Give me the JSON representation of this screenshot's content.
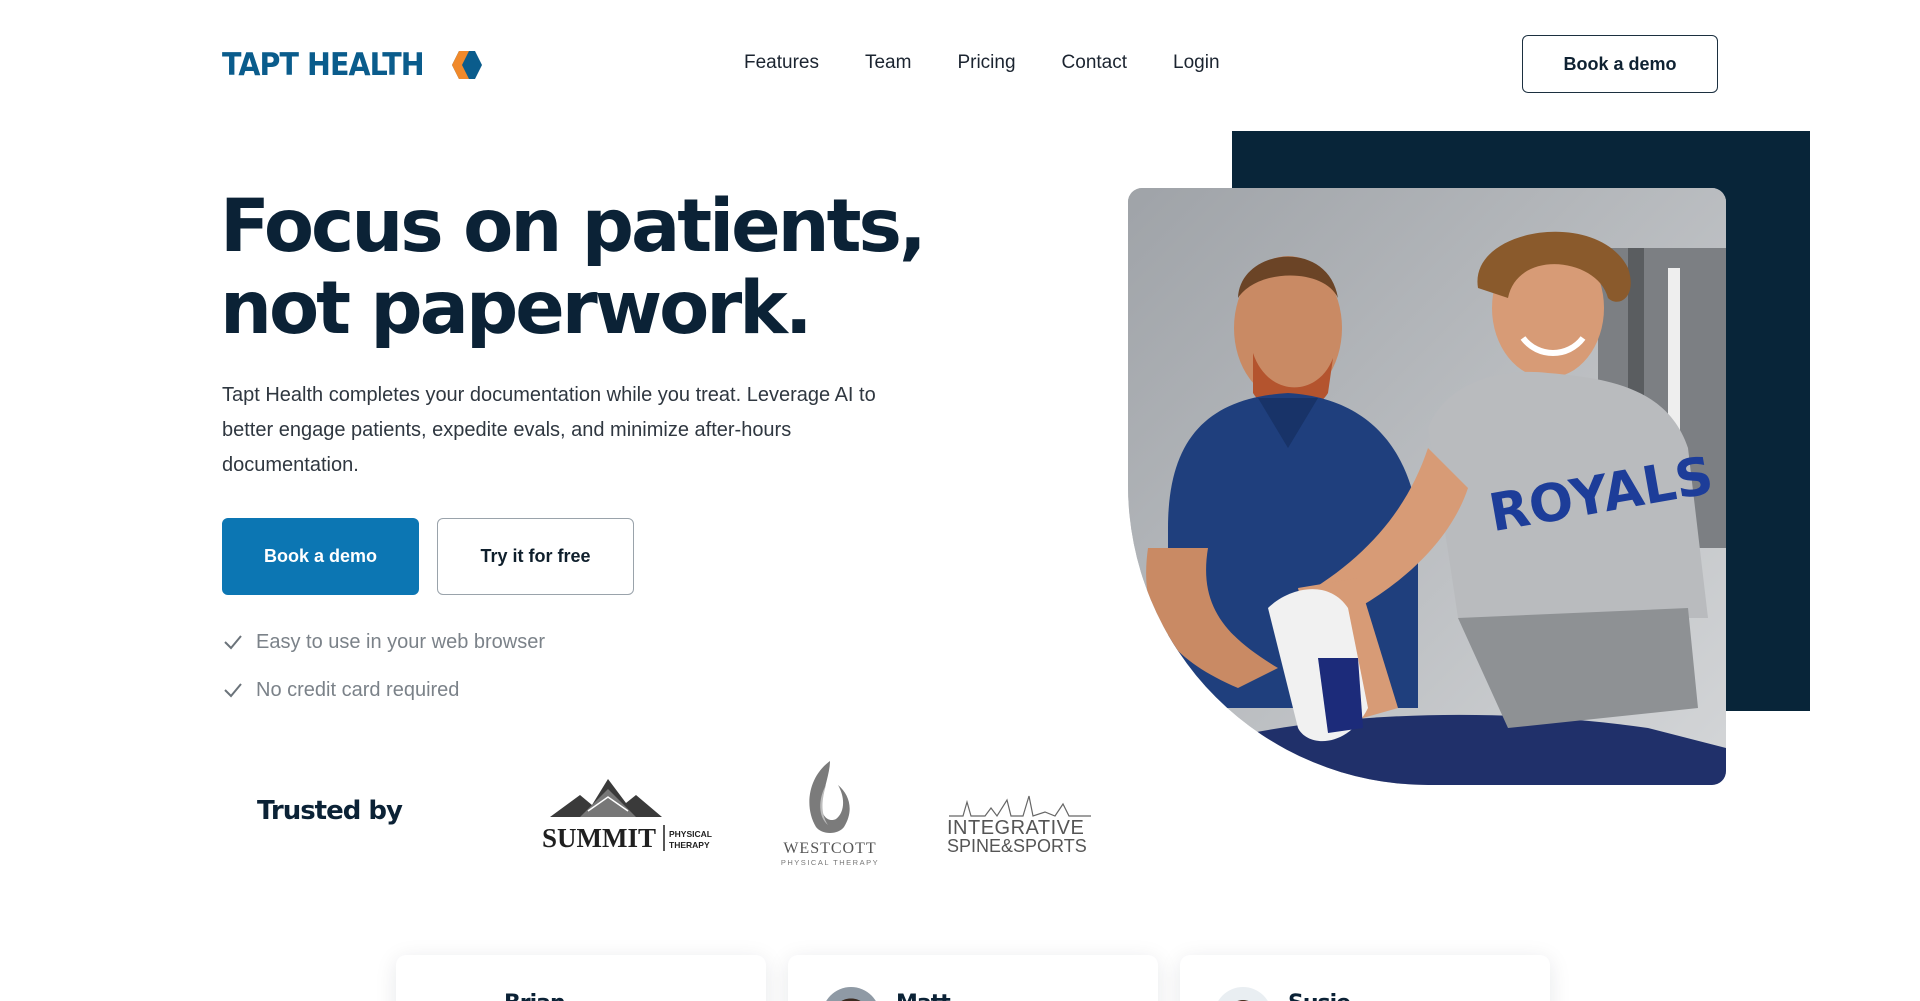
{
  "brand": {
    "name": "TAPT HEALTH",
    "primary_color": "#0c76b3",
    "navy_color": "#082539",
    "accent_orange": "#f0892b"
  },
  "nav": {
    "items": [
      "Features",
      "Team",
      "Pricing",
      "Contact",
      "Login"
    ],
    "cta": "Book a demo"
  },
  "hero": {
    "headline_line1": "Focus on patients,",
    "headline_line2": "not paperwork.",
    "description": "Tapt Health completes your documentation while you treat. Leverage AI to better engage patients, expedite evals, and minimize after-hours documentation.",
    "primary_button": "Book a demo",
    "secondary_button": "Try it for free",
    "checks": [
      "Easy to use in your web browser",
      "No credit card required"
    ],
    "image": "physical-therapist-with-patient-photo"
  },
  "trusted": {
    "label": "Trusted by",
    "logos": [
      {
        "name": "summit-physical-therapy-logo",
        "text": "SUMMIT",
        "subtext": "PHYSICAL THERAPY"
      },
      {
        "name": "westcott-physical-therapy-logo",
        "text": "WESTCOTT",
        "subtext": "PHYSICAL THERAPY"
      },
      {
        "name": "integrative-spine-sports-logo",
        "text": "INTEGRATIVE",
        "subtext": "SPINE&SPORTS"
      }
    ]
  },
  "testimonials": [
    {
      "name": "Brian"
    },
    {
      "name": "Matt"
    },
    {
      "name": "Susie"
    }
  ]
}
